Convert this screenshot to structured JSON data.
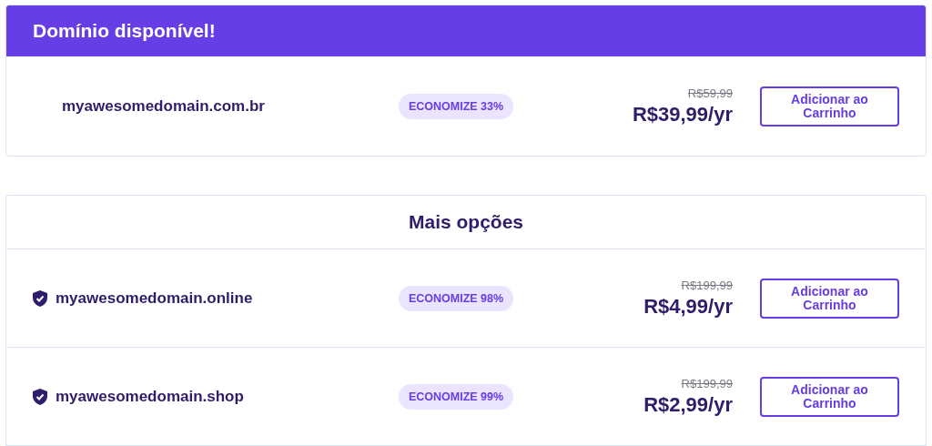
{
  "available": {
    "title": "Domínio disponível!",
    "rows": [
      {
        "domain": "myawesomedomain.com.br",
        "shield": false,
        "badge": "ECONOMIZE 33%",
        "old_price": "R$59,99",
        "price": "R$39,99/yr",
        "button": "Adicionar ao Carrinho"
      }
    ]
  },
  "more": {
    "title": "Mais opções",
    "rows": [
      {
        "domain": "myawesomedomain.online",
        "shield": true,
        "badge": "ECONOMIZE 98%",
        "old_price": "R$199,99",
        "price": "R$4,99/yr",
        "button": "Adicionar ao Carrinho"
      },
      {
        "domain": "myawesomedomain.shop",
        "shield": true,
        "badge": "ECONOMIZE 99%",
        "old_price": "R$199,99",
        "price": "R$2,99/yr",
        "button": "Adicionar ao Carrinho"
      }
    ]
  }
}
